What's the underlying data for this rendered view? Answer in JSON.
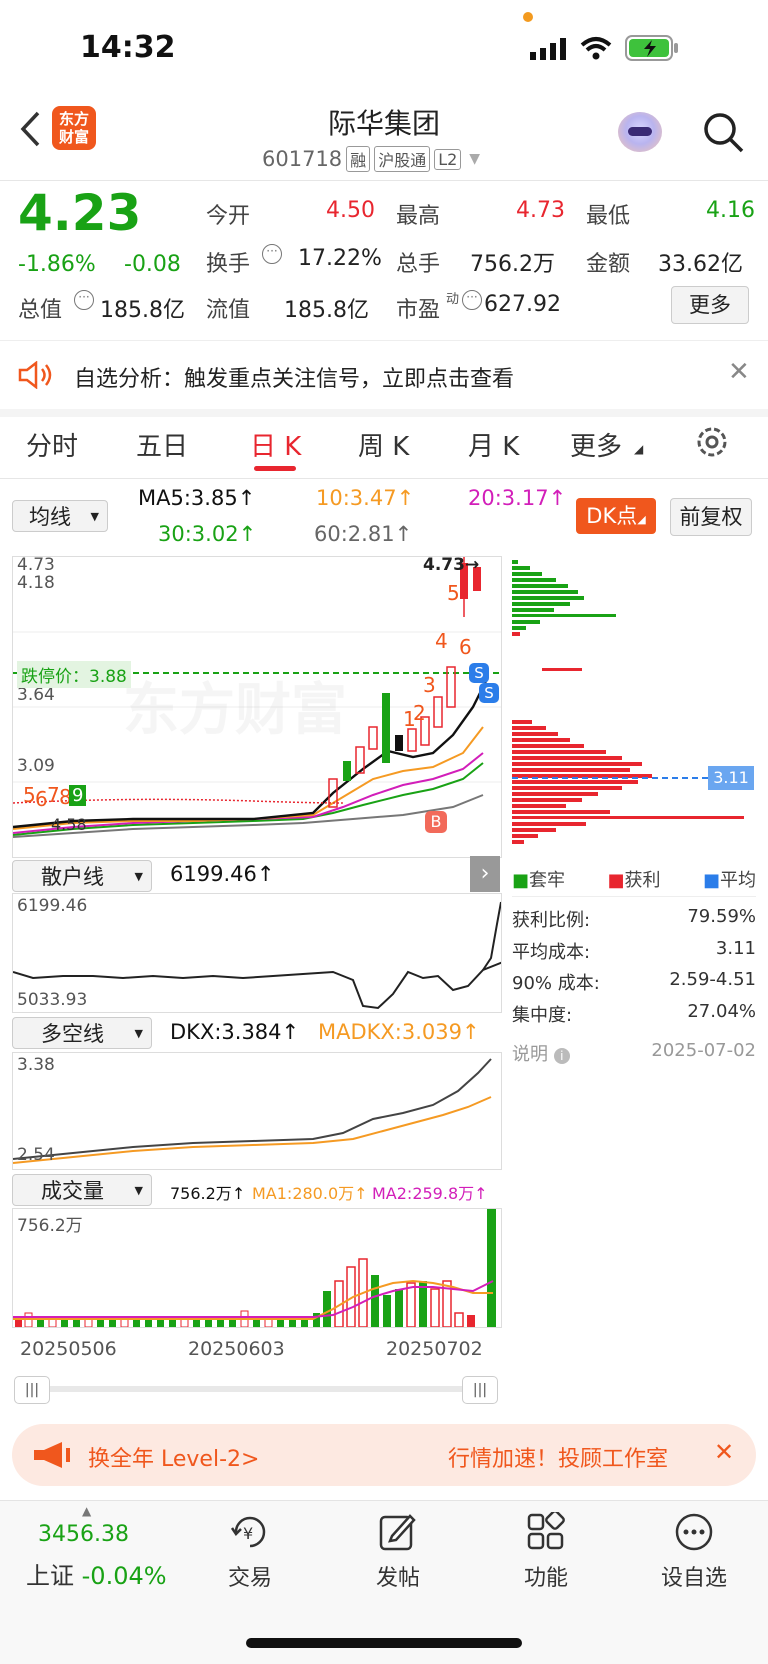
{
  "status_bar": {
    "time": "14:32"
  },
  "header": {
    "logo_line1": "东方",
    "logo_line2": "财富",
    "title": "际华集团",
    "code": "601718",
    "tags": [
      "融",
      "沪股通",
      "L2"
    ]
  },
  "quote": {
    "price": "4.23",
    "change_pct": "-1.86%",
    "change": "-0.08",
    "rows": [
      [
        {
          "label": "今开",
          "value": "4.50"
        },
        {
          "label": "最高",
          "value": "4.73"
        },
        {
          "label": "最低",
          "value": "4.16"
        }
      ],
      [
        {
          "label": "换手",
          "value": "17.22%"
        },
        {
          "label": "总手",
          "value": "756.2万"
        },
        {
          "label": "金额",
          "value": "33.62亿"
        }
      ],
      [
        {
          "label": "总值",
          "value": "185.8亿"
        },
        {
          "label": "流值",
          "value": "185.8亿"
        },
        {
          "label": "市盈",
          "sup": "动",
          "value": "627.92"
        }
      ]
    ],
    "more_label": "更多"
  },
  "notice": {
    "text": "自选分析：触发重点关注信号，立即点击查看"
  },
  "tabs": {
    "items": [
      "分时",
      "五日",
      "日 K",
      "周 K",
      "月 K",
      "更多"
    ],
    "active": "日 K"
  },
  "ma_bar": {
    "selector": "均线",
    "ma5": "MA5:3.85",
    "ma10": "10:3.47",
    "ma20": "20:3.17",
    "ma30": "30:3.02",
    "ma60": "60:2.81",
    "dk_button": "DK点",
    "adjust_button": "前复权"
  },
  "kchart": {
    "price_labels": [
      "4.73",
      "4.18",
      "3.64",
      "3.09"
    ],
    "high_marker": "4.73",
    "limit_label": "跌停价：",
    "limit_value": "3.88",
    "watermark": "东方财富",
    "signal_b": "B",
    "signal_s": "S",
    "counts_left": [
      "5",
      "6",
      "7",
      "8",
      "9"
    ],
    "counts_right": [
      "1",
      "2",
      "3",
      "4",
      "5",
      "6"
    ],
    "bottom_label": "4.58"
  },
  "chip": {
    "avg_label": "3.11",
    "legend": [
      {
        "label": "套牢",
        "color": "#19a215"
      },
      {
        "label": "获利",
        "color": "#e8262f"
      },
      {
        "label": "平均",
        "color": "#2b7de9"
      }
    ],
    "stats": [
      {
        "label": "获利比例:",
        "value": "79.59%"
      },
      {
        "label": "平均成本:",
        "value": "3.11"
      },
      {
        "label": "90% 成本:",
        "value": "2.59-4.51"
      },
      {
        "label": "集中度:",
        "value": "27.04%"
      }
    ],
    "note_label": "说明",
    "date": "2025-07-02"
  },
  "retail": {
    "selector": "散户线",
    "value": "6199.46",
    "max": "6199.46",
    "min": "5033.93"
  },
  "dkx": {
    "selector": "多空线",
    "dkx": "DKX:3.384",
    "madkx": "MADKX:3.039",
    "max": "3.38",
    "min": "2.54"
  },
  "volume": {
    "selector": "成交量",
    "value": "756.2万",
    "ma1": "MA1:280.0万",
    "ma2": "MA2:259.8万",
    "max": "756.2万",
    "dates": [
      "20250506",
      "20250603",
      "20250702"
    ]
  },
  "banner": {
    "left_text": "换全年 Level-2>",
    "right_text": "行情加速！投顾工作室"
  },
  "bottom_nav": {
    "index_value": "3456.38",
    "index_name": "上证",
    "index_change": "-0.04%",
    "items": [
      "交易",
      "发帖",
      "功能",
      "设自选"
    ]
  },
  "colors": {
    "up": "#e8262f",
    "down": "#19a215",
    "accent": "#e8262f",
    "brand": "#f0571d"
  }
}
